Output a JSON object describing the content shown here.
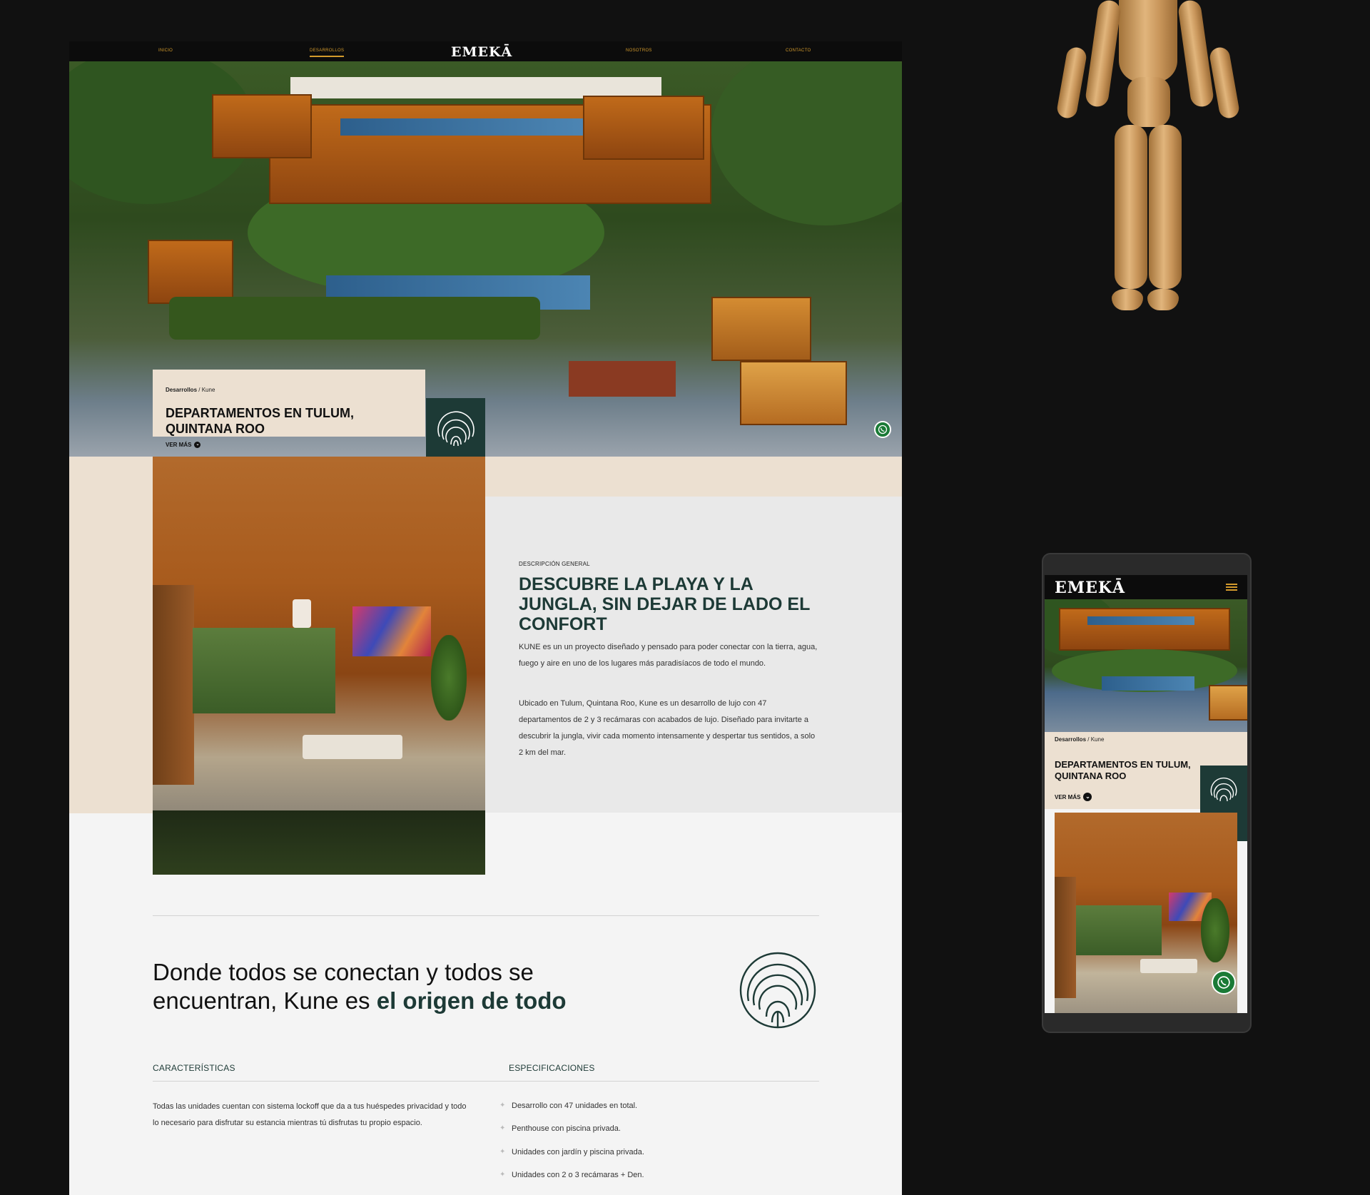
{
  "colors": {
    "accent": "#d39a2c",
    "brand_dark": "#1d3a36",
    "beige": "#ece0d1",
    "whatsapp": "#1a7a36"
  },
  "desktop": {
    "nav": {
      "items": [
        "INICIO",
        "DESARROLLOS",
        "NOSOTROS",
        "CONTACTO"
      ],
      "active": "DESARROLLOS",
      "logo": "EMEKĀ"
    },
    "hero": {
      "breadcrumb_parent": "Desarrollos",
      "breadcrumb_sep": " / ",
      "breadcrumb_current": "Kune",
      "title": "DEPARTAMENTOS EN TULUM, QUINTANA ROO",
      "cta": "VER MÁS"
    },
    "description": {
      "label": "DESCRIPCIÓN GENERAL",
      "title": "DESCUBRE LA PLAYA Y LA JUNGLA, SIN DEJAR DE LADO EL CONFORT",
      "paragraphs": [
        "KUNE es un un proyecto diseñado y pensado para poder conectar con la tierra, agua, fuego y aire en uno de los lugares más paradisíacos de todo el mundo.",
        "Ubicado en Tulum, Quintana Roo, Kune es un desarrollo de lujo con 47 departamentos de 2 y 3 recámaras con acabados de lujo. Diseñado para invitarte a descubrir la jungla, vivir cada momento intensamente y despertar tus sentidos, a solo 2 km del mar."
      ]
    },
    "tagline": {
      "text": "Donde todos se conectan y todos se encuentran, Kune es ",
      "highlight": "el origen de todo"
    },
    "caracteristicas": {
      "heading": "CARACTERÍSTICAS",
      "text": "Todas las unidades cuentan con sistema lockoff que da a tus huéspedes privacidad y todo lo necesario para disfrutar su estancia mientras tú disfrutas tu propio espacio."
    },
    "especificaciones": {
      "heading": "ESPECIFICACIONES",
      "items": [
        "Desarrollo con 47 unidades en total.",
        "Penthouse con piscina privada.",
        "Unidades con jardín y piscina privada.",
        "Unidades con 2 o 3 recámaras + Den."
      ]
    }
  },
  "mobile": {
    "logo": "EMEKĀ",
    "breadcrumb_parent": "Desarrollos",
    "breadcrumb_sep": " / ",
    "breadcrumb_current": "Kune",
    "title": "DEPARTAMENTOS EN TULUM, QUINTANA ROO",
    "cta": "VER MÁS"
  },
  "icons": {
    "whatsapp": "whatsapp-icon",
    "emblem": "kune-emblem-icon",
    "menu": "hamburger-menu-icon",
    "cta_arrow": "chevron-down-icon"
  }
}
